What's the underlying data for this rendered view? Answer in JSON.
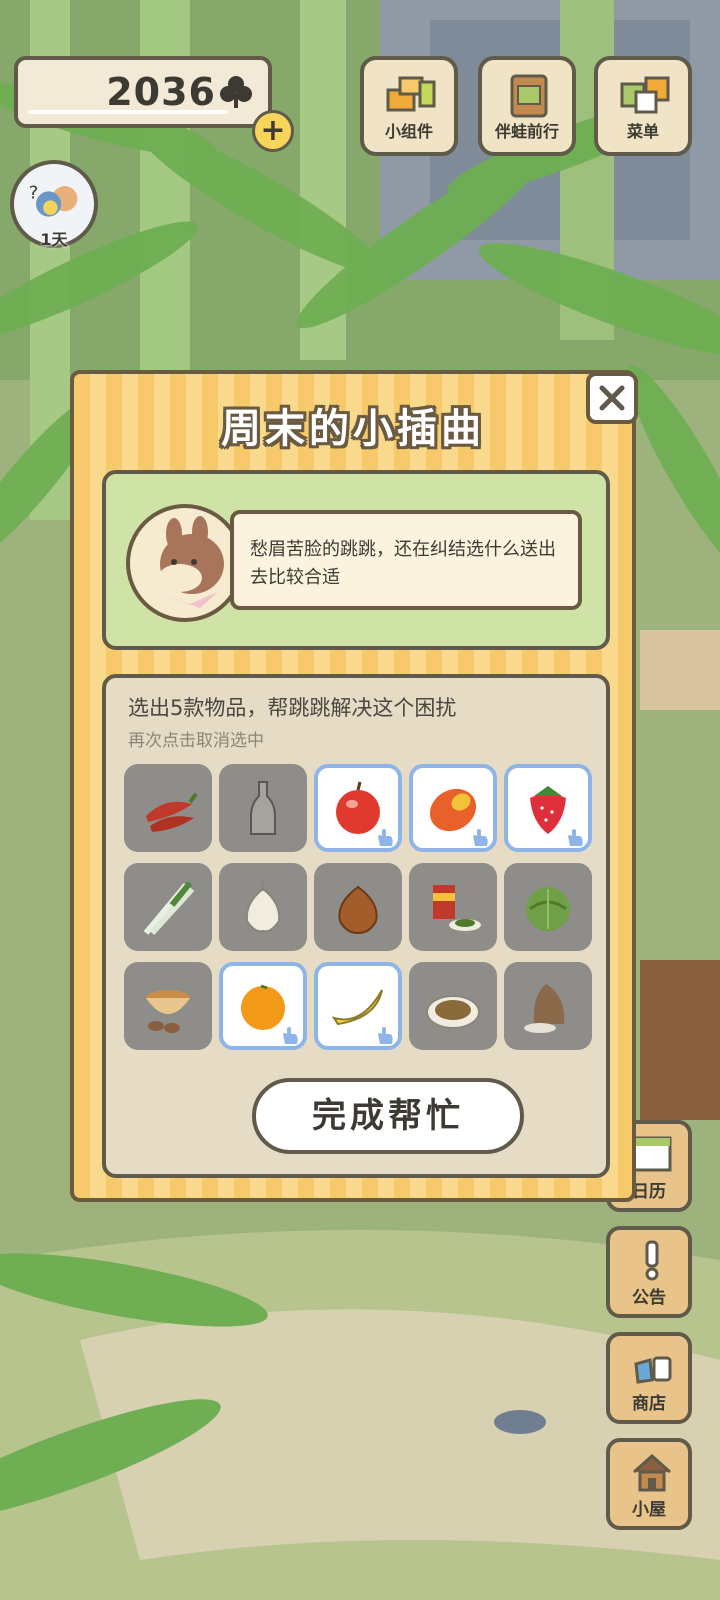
{
  "hud": {
    "clover_count": "2036",
    "plus_label": "+",
    "day_badge_label": "1天"
  },
  "top_buttons": [
    {
      "label": "小组件"
    },
    {
      "label": "伴蛙前行"
    },
    {
      "label": "菜单"
    }
  ],
  "side_buttons": [
    {
      "label": "日历"
    },
    {
      "label": "公告"
    },
    {
      "label": "商店"
    },
    {
      "label": "小屋"
    }
  ],
  "dialog": {
    "title": "周末的小插曲",
    "close_label": "✕",
    "story_text": "愁眉苦脸的跳跳，还在纠结选什么送出去比较合适",
    "instruction": "选出5款物品，帮跳跳解决这个困扰",
    "hint": "再次点击取消选中",
    "items": [
      {
        "icon": "chili-pepper-icon",
        "selected": false
      },
      {
        "icon": "bottle-icon",
        "selected": false
      },
      {
        "icon": "apple-icon",
        "selected": true
      },
      {
        "icon": "mango-icon",
        "selected": true
      },
      {
        "icon": "strawberry-icon",
        "selected": true
      },
      {
        "icon": "green-onion-icon",
        "selected": false
      },
      {
        "icon": "garlic-icon",
        "selected": false
      },
      {
        "icon": "onion-icon",
        "selected": false
      },
      {
        "icon": "canned-food-icon",
        "selected": false
      },
      {
        "icon": "cabbage-icon",
        "selected": false
      },
      {
        "icon": "soup-bowl-icon",
        "selected": false
      },
      {
        "icon": "orange-icon",
        "selected": true
      },
      {
        "icon": "banana-icon",
        "selected": true
      },
      {
        "icon": "dish-icon",
        "selected": false
      },
      {
        "icon": "rice-sack-icon",
        "selected": false
      }
    ],
    "done_button_label": "完成帮忙"
  },
  "colors": {
    "dialog_stripe_a": "#f6c96a",
    "dialog_stripe_b": "#f9d98c",
    "selected_border": "#8fb4e8",
    "outline": "#5f5a4a"
  }
}
